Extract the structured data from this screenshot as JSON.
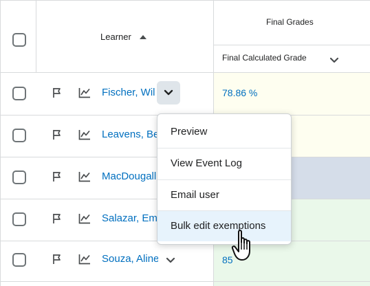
{
  "header": {
    "learner_label": "Learner",
    "final_grades_label": "Final Grades",
    "final_calculated_label": "Final Calculated Grade"
  },
  "rows": [
    {
      "name": "Fischer, Wil",
      "grade": "78.86 %",
      "grade_bg": "#fefef0"
    },
    {
      "name": "Leavens, Ber",
      "grade": "",
      "grade_bg": "#fefef0"
    },
    {
      "name": "MacDougall,",
      "grade": "",
      "grade_bg": "#d5dde9"
    },
    {
      "name": "Salazar, Emil",
      "grade": "",
      "grade_bg": "#eaf8ea"
    },
    {
      "name": "Souza, Aline",
      "grade": "85",
      "grade_bg": "#eaf8ea"
    }
  ],
  "context_menu": {
    "items": [
      "Preview",
      "View Event Log",
      "Email user",
      "Bulk edit exemptions"
    ]
  },
  "colors": {
    "link": "#006fbf",
    "menu_hover": "#e7f3fc",
    "dropdown_button": "#dfe5ea"
  },
  "icons": [
    "flag-icon",
    "trend-chart-icon",
    "chevron-down-icon",
    "sort-ascending-icon",
    "hand-pointer-cursor-icon"
  ]
}
